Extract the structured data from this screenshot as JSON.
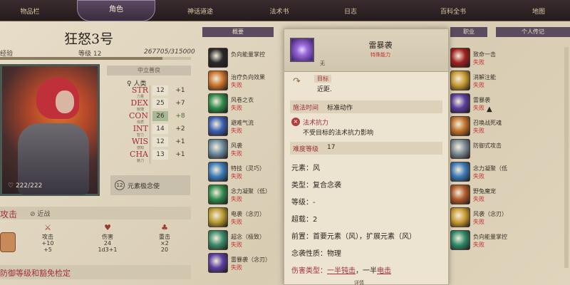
{
  "top_tabs": [
    {
      "label": "物品栏"
    },
    {
      "label": "角色"
    },
    {
      "label": "神话道途"
    },
    {
      "label": "法术书"
    },
    {
      "label": "日志"
    },
    {
      "label": "百科全书"
    },
    {
      "label": "地图"
    }
  ],
  "character": {
    "name": "狂怒3号",
    "level_label": "等级 12",
    "xp_label": "经验",
    "xp": "267705/315000",
    "xp_fraction": 0.85,
    "hp": "222/222",
    "alignment": "中立善良",
    "race": "人类",
    "stats": [
      {
        "name": "STR",
        "sub": "力量",
        "value": "12",
        "mod": "+1",
        "hi": false
      },
      {
        "name": "DEX",
        "sub": "敏捷",
        "value": "25",
        "mod": "+7",
        "hi": false
      },
      {
        "name": "CON",
        "sub": "体质",
        "value": "26",
        "mod": "+8",
        "hi": true
      },
      {
        "name": "INT",
        "sub": "智力",
        "value": "14",
        "mod": "+2",
        "hi": false
      },
      {
        "name": "WIS",
        "sub": "感知",
        "value": "12",
        "mod": "+1",
        "hi": false
      },
      {
        "name": "CHA",
        "sub": "魅力",
        "value": "13",
        "mod": "+1",
        "hi": false
      }
    ],
    "element_badge": "12",
    "element_text": "元素极念使"
  },
  "attack": {
    "title": "攻击",
    "sub": "近战",
    "cols": [
      {
        "label": "攻击",
        "line1": "+10",
        "line2": "+5"
      },
      {
        "label": "伤害",
        "line1": "24",
        "line2": "1d3+1"
      },
      {
        "label": "重击",
        "line1": "×2",
        "line2": "20"
      }
    ]
  },
  "defense": {
    "title": "防御等级和豁免检定"
  },
  "section_tabs": {
    "left": "概要",
    "mid": "职业",
    "right": "个人传记"
  },
  "spells_left": [
    {
      "name": "负向能量掌控",
      "fail": ""
    },
    {
      "name": "治疗负向效果",
      "fail": "失败"
    },
    {
      "name": "风卷之衣",
      "fail": "失败"
    },
    {
      "name": "避难气流",
      "fail": "失败"
    },
    {
      "name": "风袭",
      "fail": "失败"
    },
    {
      "name": "特技（灵巧）",
      "fail": "失败"
    },
    {
      "name": "念力凝聚（低）",
      "fail": "失败"
    },
    {
      "name": "电袭（念刃）",
      "fail": "失败"
    },
    {
      "name": "超念（极致）",
      "fail": "失败"
    },
    {
      "name": "雷暴袭（念刃）",
      "fail": "失败"
    }
  ],
  "spells_right": [
    {
      "name": "致命一击",
      "fail": "失败"
    },
    {
      "name": "消解注能",
      "fail": "失败"
    },
    {
      "name": "雷暴袭",
      "fail": "失败"
    },
    {
      "name": "召唤战死魂",
      "fail": "失败"
    },
    {
      "name": "防御式攻击",
      "fail": ""
    },
    {
      "name": "念力凝聚（低",
      "fail": "失败"
    },
    {
      "name": "野兔魔宠",
      "fail": "失败"
    },
    {
      "name": "风袭（念刃）",
      "fail": "失败"
    },
    {
      "name": "负向能量掌控",
      "fail": "失败"
    }
  ],
  "detail": {
    "title": "雷暴袭",
    "subtitle": "特殊能力",
    "none_label": "无",
    "target_label": "目标",
    "target_value": "近距.",
    "cast_label": "施法时间",
    "cast_value": "标准动作",
    "resist_label": "法术抗力",
    "resist_value": "不受目标的法术抗力影响",
    "dc_label": "难度等级",
    "dc_value": "17",
    "element": "元素：风",
    "type": "类型：复合念袭",
    "level": "等级：-",
    "burn": "超载：2",
    "prereq": "前置：首要元素（风），扩展元素（风）",
    "nature": "念袭性质：物理",
    "dmg_label": "伤害类型：",
    "dmg_a": "一半钝击",
    "dmg_mid": "，一半",
    "dmg_b": "电击",
    "footer": "详情"
  }
}
